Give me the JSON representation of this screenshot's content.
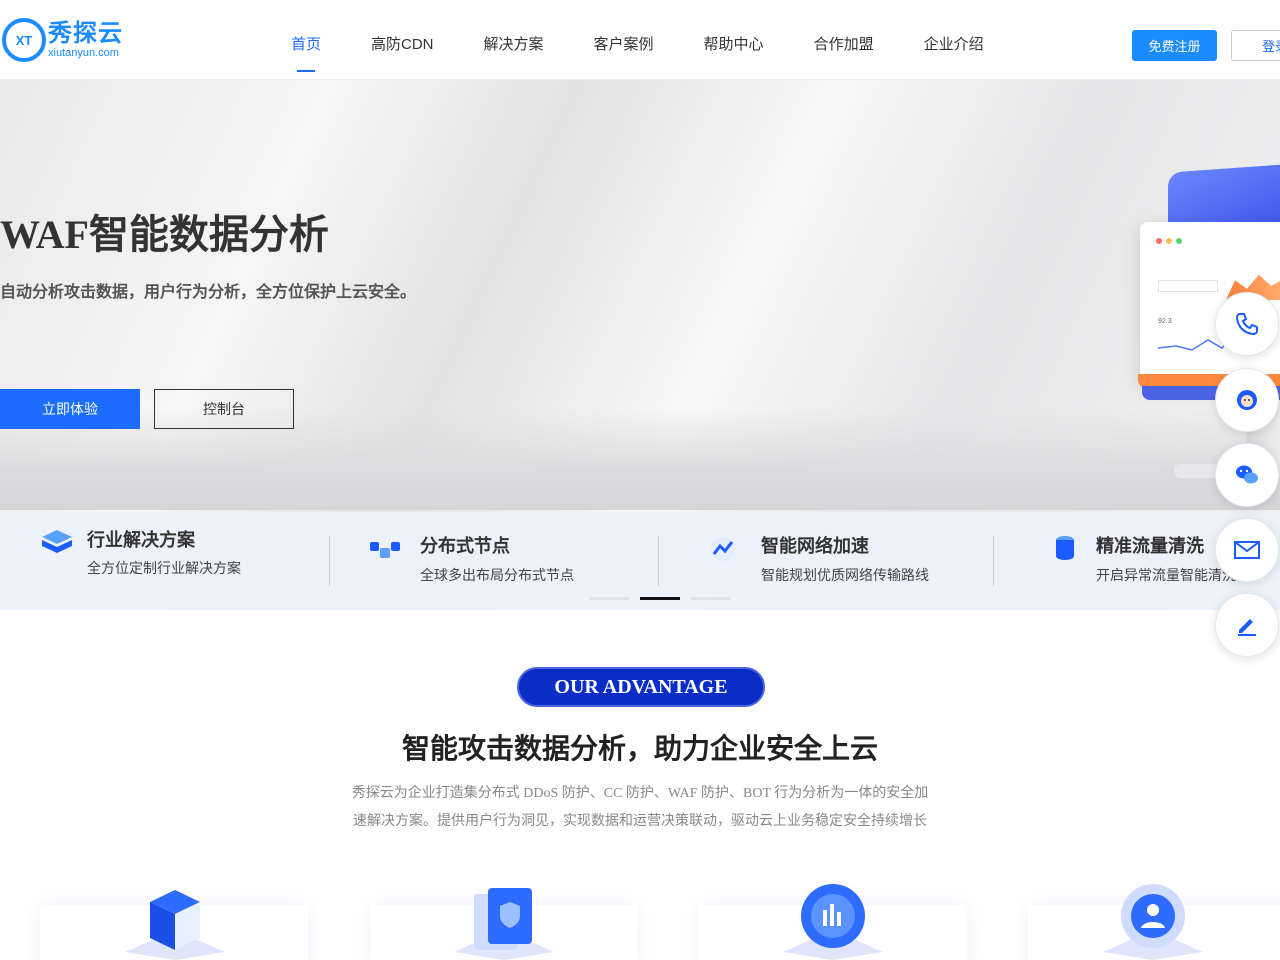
{
  "header": {
    "logo": {
      "mark": "XT",
      "name": "秀探云",
      "domain": "xiutanyun.com"
    },
    "nav": [
      {
        "label": "首页",
        "active": true
      },
      {
        "label": "高防CDN",
        "active": false
      },
      {
        "label": "解决方案",
        "active": false
      },
      {
        "label": "客户案例",
        "active": false
      },
      {
        "label": "帮助中心",
        "active": false
      },
      {
        "label": "合作加盟",
        "active": false
      },
      {
        "label": "企业介绍",
        "active": false
      }
    ],
    "register_label": "免费注册",
    "login_label": "登录"
  },
  "hero": {
    "title": "WAF智能数据分析",
    "subtitle": "自动分析攻击数据，用户行为分析，全方位保护上云安全。",
    "try_label": "立即体验",
    "console_label": "控制台",
    "screen_value": "92.3"
  },
  "features": [
    {
      "title": "行业解决方案",
      "desc": "全方位定制行业解决方案",
      "icon": "layers-icon"
    },
    {
      "title": "分布式节点",
      "desc": "全球多出布局分布式节点",
      "icon": "nodes-icon"
    },
    {
      "title": "智能网络加速",
      "desc": "智能规划优质网络传输路线",
      "icon": "accelerate-icon"
    },
    {
      "title": "精准流量清洗",
      "desc": "开启异常流量智能清洗",
      "icon": "database-icon"
    }
  ],
  "carousel": {
    "count": 3,
    "active": 1
  },
  "side_tools": [
    "phone-icon",
    "customer-service-icon",
    "wechat-icon",
    "mail-icon",
    "edit-icon"
  ],
  "advantage": {
    "badge": "OUR ADVANTAGE",
    "title": "智能攻击数据分析，助力企业安全上云",
    "desc_line1": "秀探云为企业打造集分布式 DDoS 防护、CC 防护、WAF 防护、BOT 行为分析为一体的安全加",
    "desc_line2": "速解决方案。提供用户行为洞见，实现数据和运营决策联动，驱动云上业务稳定安全持续增长"
  },
  "colors": {
    "primary": "#1a6dff",
    "brand": "#1a8cff",
    "badge": "#0a2dc5"
  }
}
